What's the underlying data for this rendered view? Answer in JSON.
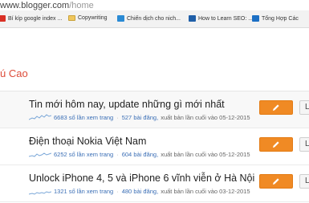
{
  "browser": {
    "url_host": "www.blogger.com",
    "url_path": "/home",
    "bookmarks": [
      {
        "label": "Bí kíp google index ...",
        "icon": "red-favicon-icon"
      },
      {
        "label": "Copywriting",
        "icon": "folder-icon"
      },
      {
        "label": "Chiến dịch cho nich...",
        "icon": "sheet-icon"
      },
      {
        "label": "How to Learn SEO: ...",
        "icon": "m-favicon-icon"
      },
      {
        "label": "Tổng Hợp Các",
        "icon": "v-favicon-icon"
      }
    ]
  },
  "blog": {
    "title": "ú Cao"
  },
  "posts": [
    {
      "title": "Tin mới hôm nay, update những gì mới nhất",
      "views": "6683 số lần xem trang",
      "count": "527 bài đăng,",
      "published": "xuất bản lần cuối vào 05-12-2015",
      "view_label": "L"
    },
    {
      "title": "Điện thoại Nokia Việt Nam",
      "views": "6252 số lần xem trang",
      "count": "604 bài đăng,",
      "published": "xuất bản lần cuối vào 05-12-2015",
      "view_label": "L"
    },
    {
      "title": "Unlock iPhone 4, 5 và iPhone 6 vĩnh viễn ở Hà Nội",
      "views": "1321 số lần xem trang",
      "count": "480 bài đăng,",
      "published": "xuất bản lần cuối vào 03-12-2015",
      "view_label": "L"
    }
  ],
  "colors": {
    "accent_orange": "#f08a24",
    "title_red": "#dd4b39",
    "link_blue": "#3b6fb6"
  }
}
